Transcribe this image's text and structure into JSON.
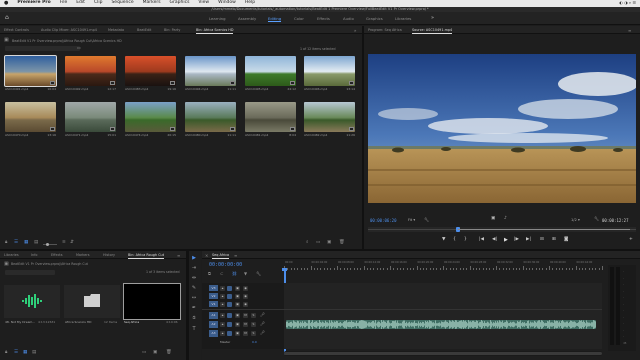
{
  "menubar": {
    "apple": "",
    "app_name": "Premiere Pro",
    "items": [
      "File",
      "Edit",
      "Clip",
      "Sequence",
      "Markers",
      "Graphics",
      "View",
      "Window",
      "Help"
    ]
  },
  "path_bar": "/Users/mmelo/Documents/tutorials/_automation/tutorials/BeatEdit 1 Premiere Overview/FullBeatEdit V1 Pr Overview.prproj *",
  "workspaces": {
    "items": [
      "Learning",
      "Assembly",
      "Editing",
      "Color",
      "Effects",
      "Audio",
      "Graphics",
      "Libraries"
    ],
    "active": "Editing"
  },
  "source_panel": {
    "tabs": [
      "Effect Controls",
      "Audio Clip Mixer: ASC10491.mp4",
      "Metadata",
      "BeatEdit",
      "Bin: Party",
      "Bin: Africa Scenics HD"
    ],
    "active_tab": "Bin: Africa Scenics HD",
    "breadcrumb": "BeatEdit V1 Pr Overview.prproj\\Africa Rough Cut\\Africa Scenics HD",
    "items_selected": "1 of 12 items selected",
    "clips": [
      {
        "name": "ASC10491.mp4",
        "duration": "10:04",
        "colors": [
          "#2f5f9e",
          "#7c95a8",
          "#c8a46a",
          "#6a4a2a"
        ]
      },
      {
        "name": "ASC10492.mp4",
        "duration": "12:17",
        "colors": [
          "#e07a2e",
          "#b8482a",
          "#4a2a1a",
          "#2a1810"
        ]
      },
      {
        "name": "ASC10483.mp4",
        "duration": "19:16",
        "colors": [
          "#d9502a",
          "#9e3a1e",
          "#3a2216",
          "#1a1210"
        ]
      },
      {
        "name": "ASC10494.mp4",
        "duration": "11:11",
        "colors": [
          "#6a95c8",
          "#dfe8f0",
          "#aab8c4",
          "#6a7a5a"
        ]
      },
      {
        "name": "ASC10495.mp4",
        "duration": "24:12",
        "colors": [
          "#8fb5d8",
          "#c9dbe8",
          "#3e7a2a",
          "#2d5a1a"
        ]
      },
      {
        "name": "ASC10496.mp4",
        "duration": "13:14",
        "colors": [
          "#7da5d0",
          "#e4ecf2",
          "#8a9a6a",
          "#5a6a3a"
        ]
      },
      {
        "name": "ASC10470.mp4",
        "duration": "13:16",
        "colors": [
          "#c8c0a0",
          "#a88a5a",
          "#7a6a4a",
          "#5a4a32"
        ]
      },
      {
        "name": "ASC10471.mp4",
        "duration": "15:01",
        "colors": [
          "#a0a8a8",
          "#7a8a7a",
          "#5a6a5a",
          "#3a4a3a"
        ]
      },
      {
        "name": "ASC10474.mp4",
        "duration": "20:15",
        "colors": [
          "#7aa0c8",
          "#5a8a4a",
          "#3a6a2a",
          "#5a5a3a"
        ]
      },
      {
        "name": "ASC10480.mp4",
        "duration": "11:11",
        "colors": [
          "#9ab0c0",
          "#5a7a5a",
          "#3a5a2a",
          "#7a6a4a"
        ]
      },
      {
        "name": "ASC10481.mp4",
        "duration": "8:04",
        "colors": [
          "#9a9a88",
          "#6a6a5a",
          "#4a4a3a",
          "#7a7a66"
        ]
      },
      {
        "name": "ASC10482.mp4",
        "duration": "11:26",
        "colors": [
          "#b8c8d4",
          "#6a8a5a",
          "#3a5a2a",
          "#8a7a5a"
        ]
      }
    ]
  },
  "program_panel": {
    "tabs": [
      "Program: Seq Africa",
      "Source: ASC10491.mp4"
    ],
    "active_tab": "Source: ASC10491.mp4",
    "timecode_current": "00:00:06:20",
    "fit_label": "Fit",
    "zoom_label": "1/2",
    "timecode_duration": "00:00:12:27"
  },
  "project_panel": {
    "tabs": [
      "Libraries",
      "Info",
      "Effects",
      "Markers",
      "History",
      "Bin: Africa Rough Cut"
    ],
    "active_tab": "Bin: Africa Rough Cut",
    "breadcrumb": "BeatEdit V1 Pr Overview.prproj\\Africa Rough Cut",
    "items_selected": "1 of 3 items selected",
    "items": [
      {
        "name": "48. Not My Dream...",
        "info": "4:13:12631"
      },
      {
        "name": "Africa Scenics HD",
        "info": "12 Items"
      },
      {
        "name": "Seq Africa",
        "info": "4:19:06"
      }
    ]
  },
  "timeline": {
    "tab": "Seq Africa",
    "timecode": "00:00:00:00",
    "ruler_labels": [
      "00:00",
      "00:00:04:00",
      "00:00:08:00",
      "00:00:12:00",
      "00:00:16:00",
      "00:00:20:00",
      "00:00:24:00",
      "00:00:28:00",
      "00:00:32:00",
      "00:00:36:00",
      "00:00:40:00",
      "00:00:44:00"
    ],
    "video_tracks": [
      "V3",
      "V2",
      "V1"
    ],
    "audio_tracks": [
      "A1",
      "A2",
      "A3"
    ],
    "master_label": "Master",
    "master_value": "0.0",
    "audio_clip_color": "#3f6e63"
  }
}
